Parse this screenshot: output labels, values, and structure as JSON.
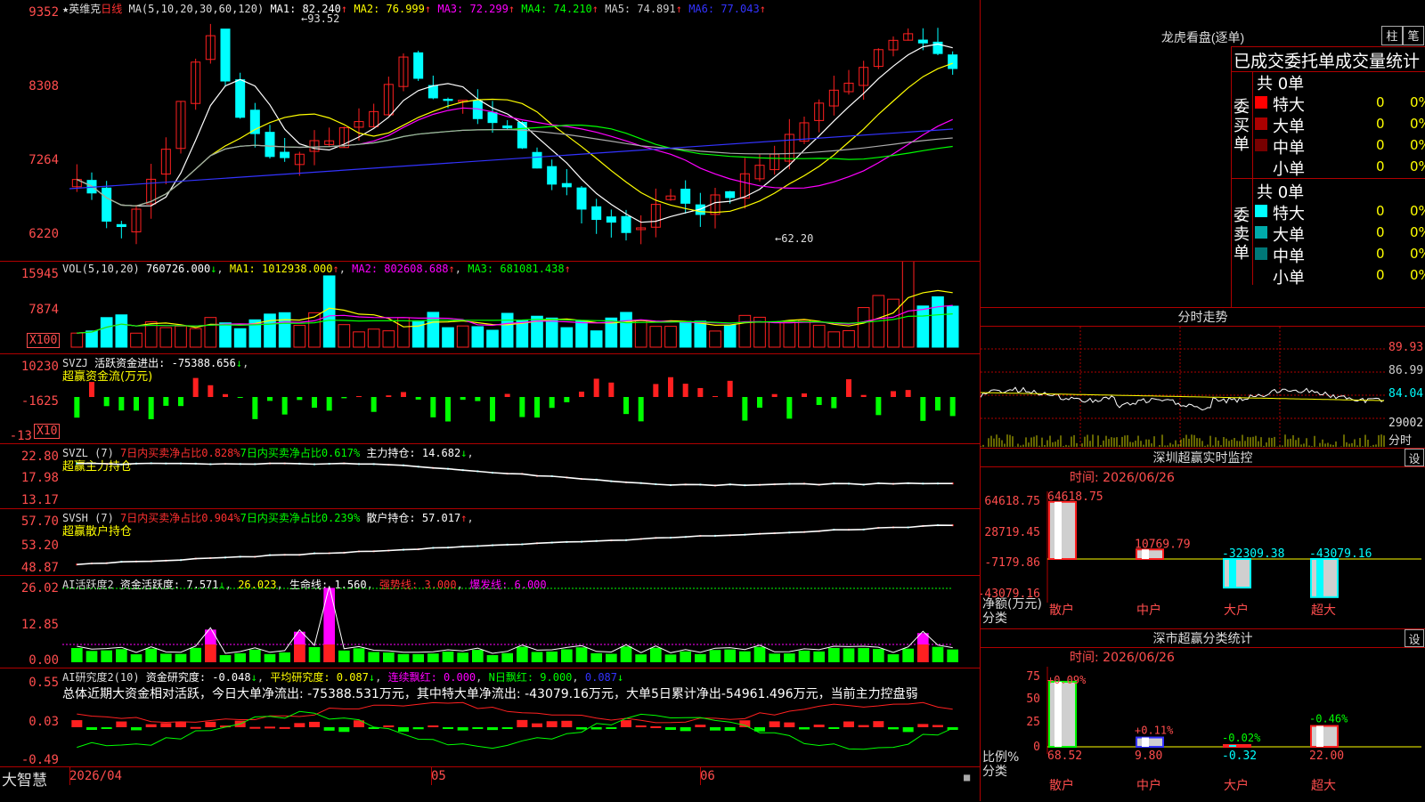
{
  "colors": {
    "up": "#ff2020",
    "down": "#00ffff",
    "grid": "#b00000",
    "text_red": "#ff4d4d",
    "white": "#ffffff",
    "yellow": "#ffff00",
    "magenta": "#ff00ff",
    "green": "#00ff00",
    "blue": "#3333ff"
  },
  "main_chart": {
    "title_prefix": "★英维克",
    "period": "日线",
    "ma_params": "MA(5,10,20,30,60,120)",
    "ma1": "MA1: 82.240",
    "ma2": "MA2: 76.999",
    "ma3": "MA3: 72.299",
    "ma4": "MA4: 74.210",
    "ma5": "MA5: 74.891",
    "ma6": "MA6: 77.043",
    "high_label": "93.52",
    "low_label": "62.20",
    "axis": [
      "9352",
      "8308",
      "7264",
      "6220"
    ]
  },
  "vol_panel": {
    "label": "VOL(5,10,20)",
    "val": "760726.000",
    "ma1": "MA1: 1012938.000",
    "ma2": "MA2: 802608.688",
    "ma3": "MA3: 681081.438",
    "axis": [
      "15945",
      "7874"
    ],
    "mult": "X100"
  },
  "svzj_panel": {
    "label": "SVZJ",
    "text": "活跃资金进出: -75388.656",
    "sub": "超赢资金流(万元)",
    "axis": [
      "10230",
      "-1625",
      "-13"
    ],
    "mult": "X10"
  },
  "svzl_panel": {
    "label": "SVZL (7)",
    "t1": "7日内买卖净占比0.828%",
    "t2": "7日内买卖净占比0.617%",
    "t3": "主力持仓: 14.682",
    "sub": "超赢主力持仓",
    "axis": [
      "22.80",
      "17.98",
      "13.17"
    ]
  },
  "svsh_panel": {
    "label": "SVSH (7)",
    "t1": "7日内买卖净占比0.904%",
    "t2": "7日内买卖净占比0.239%",
    "t3": "散户持仓: 57.017",
    "sub": "超赢散户持仓",
    "axis": [
      "57.70",
      "53.20",
      "48.87"
    ]
  },
  "ai_active_panel": {
    "label": "AI活跃度2",
    "t1": "资金活跃度: 7.571",
    "t2": "26.023",
    "t3": "生命线: 1.560",
    "t4": "强势线: 3.000",
    "t5": "爆发线: 6.000",
    "axis": [
      "26.02",
      "12.85",
      "0.00"
    ]
  },
  "ai_research_panel": {
    "label": "AI研究度2(10)",
    "t1": "资金研究度: -0.048",
    "t2": "平均研究度: 0.087",
    "t3": "连续飘红: 0.000",
    "t4": "N日飘红: 9.000",
    "t5": "0.087",
    "summary": "总体近期大资金相对活跃，今日大单净流出: -75388.531万元，其中特大单净流出: -43079.16万元，大单5日累计净出-54961.496万元，当前主力控盘弱",
    "axis": [
      "0.55",
      "0.03",
      "-0.49"
    ]
  },
  "time_axis": {
    "brand": "大智慧",
    "labels": [
      "2026/04",
      "05",
      "06"
    ]
  },
  "lhb": {
    "title": "龙虎看盘(逐单)",
    "btn1": "柱",
    "btn2": "笔",
    "header": "已成交委托单成交量统计",
    "buy_label": "委买单",
    "sell_label": "委卖单",
    "total_buy": "共 0单",
    "total_sell": "共 0单",
    "rows_buy": [
      {
        "name": "特大",
        "v": "0",
        "p": "0%",
        "color": "#ff0000"
      },
      {
        "name": "大单",
        "v": "0",
        "p": "0%",
        "color": "#aa0000"
      },
      {
        "name": "中单",
        "v": "0",
        "p": "0%",
        "color": "#770000"
      },
      {
        "name": "小单",
        "v": "0",
        "p": "0%",
        "color": "#000000"
      }
    ],
    "rows_sell": [
      {
        "name": "特大",
        "v": "0",
        "p": "0%",
        "color": "#00ffff"
      },
      {
        "name": "大单",
        "v": "0",
        "p": "0%",
        "color": "#00aaaa"
      },
      {
        "name": "中单",
        "v": "0",
        "p": "0%",
        "color": "#007777"
      },
      {
        "name": "小单",
        "v": "0",
        "p": "0%",
        "color": "#000000"
      }
    ]
  },
  "fenshi": {
    "title": "分时走势",
    "axis": [
      "89.93",
      "86.99",
      "84.04",
      "29002",
      "分时"
    ]
  },
  "sz_monitor": {
    "title": "深圳超赢实时监控",
    "btn": "设",
    "time": "时间: 2026/06/26",
    "axis": [
      "64618.75",
      "28719.45",
      "-7179.86",
      "-43079.16"
    ],
    "ylabel": "净额(万元)",
    "xlabel": "分类",
    "bars": [
      {
        "name": "散户",
        "value": 64618.75,
        "label": "64618.75"
      },
      {
        "name": "中户",
        "value": 10769.79,
        "label": "10769.79"
      },
      {
        "name": "大户",
        "value": -32309.38,
        "label": "-32309.38"
      },
      {
        "name": "超大",
        "value": -43079.16,
        "label": "-43079.16"
      }
    ]
  },
  "sz_class": {
    "title": "深市超赢分类统计",
    "btn": "设",
    "time": "时间: 2026/06/26",
    "axis": [
      "75",
      "50",
      "25",
      "0"
    ],
    "ylabel": "比例%",
    "xlabel": "分类",
    "bars": [
      {
        "name": "散户",
        "value": 68.52,
        "label": "68.52",
        "chg": "+0.09%"
      },
      {
        "name": "中户",
        "value": 9.8,
        "label": "9.80",
        "chg": "+0.11%"
      },
      {
        "name": "大户",
        "value": -0.32,
        "label": "-0.32",
        "chg": "-0.02%"
      },
      {
        "name": "超大",
        "value": 22.0,
        "label": "22.00",
        "chg": "-0.46%"
      }
    ]
  },
  "chart_data": {
    "type": "bar",
    "categories": [
      "散户",
      "中户",
      "大户",
      "超大"
    ],
    "values": [
      64618.75,
      10769.79,
      -32309.38,
      -43079.16
    ],
    "title": "深圳超赢实时监控",
    "ylabel": "净额(万元)",
    "xlabel": "分类",
    "ylim": [
      -43079.16,
      64618.75
    ]
  }
}
